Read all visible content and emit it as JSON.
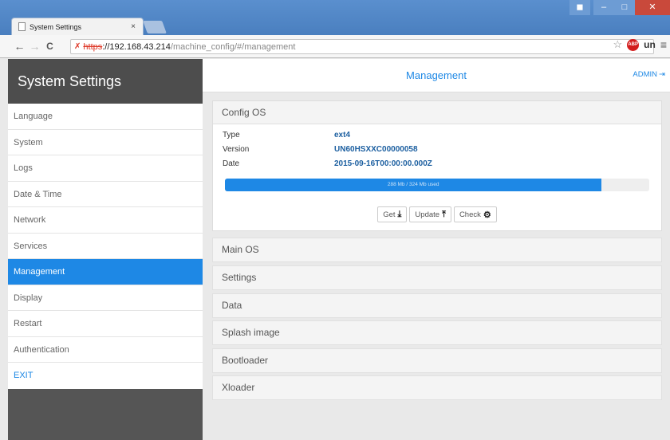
{
  "browser": {
    "tab_title": "System Settings",
    "tab_close": "×",
    "url_scheme": "https",
    "url_host": "://192.168.43.214",
    "url_path": "/machine_config/#/management",
    "extension_label": "un",
    "adblock_label": "ABP"
  },
  "sidebar": {
    "title": "System Settings",
    "items": [
      {
        "label": "Language"
      },
      {
        "label": "System"
      },
      {
        "label": "Logs"
      },
      {
        "label": "Date & Time"
      },
      {
        "label": "Network"
      },
      {
        "label": "Services"
      },
      {
        "label": "Management",
        "active": true
      },
      {
        "label": "Display"
      },
      {
        "label": "Restart"
      },
      {
        "label": "Authentication"
      },
      {
        "label": "EXIT"
      }
    ]
  },
  "header": {
    "title": "Management",
    "user": "ADMIN"
  },
  "config_os": {
    "title": "Config OS",
    "type_label": "Type",
    "type_value": "ext4",
    "version_label": "Version",
    "version_value": "UN60HSXXC00000058",
    "date_label": "Date",
    "date_value": "2015-09-16T00:00:00.000Z",
    "usage_text": "288 Mb / 324 Mb used",
    "usage_fraction": 0.888,
    "buttons": {
      "get": "Get",
      "update": "Update",
      "check": "Check"
    }
  },
  "sections": [
    "Main OS",
    "Settings",
    "Data",
    "Splash image",
    "Bootloader",
    "Xloader"
  ],
  "colors": {
    "accent": "#1e88e5",
    "sidebar": "#555555"
  }
}
